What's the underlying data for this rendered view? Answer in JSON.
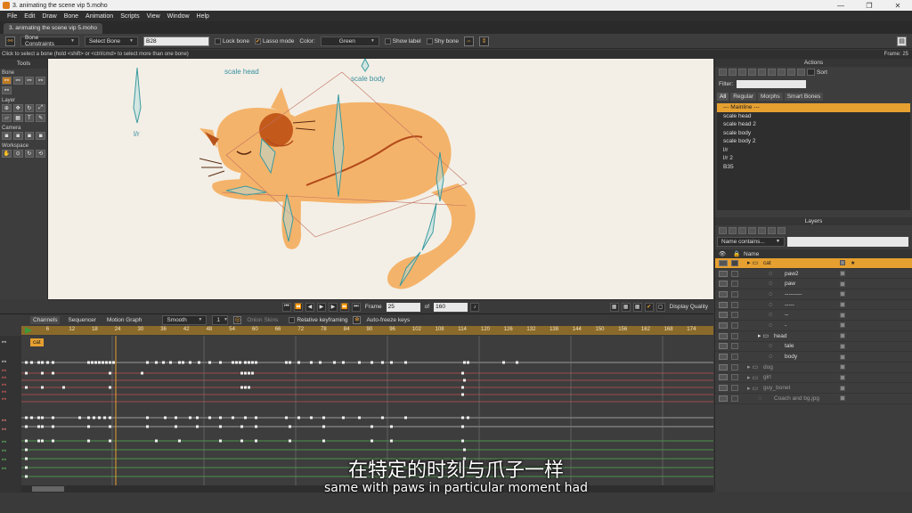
{
  "window": {
    "title": "3. animating the scene vip 5.moho",
    "controls": [
      "—",
      "❐",
      "✕"
    ]
  },
  "menu": [
    "File",
    "Edit",
    "Draw",
    "Bone",
    "Animation",
    "Scripts",
    "View",
    "Window",
    "Help"
  ],
  "doc_tab": "3. animating the scene vip 5.moho",
  "tool_options": {
    "bone_constraints": "Bone Constraints",
    "select_bone": "Select Bone",
    "bone_name": "B28",
    "lock_bone": "Lock bone",
    "lasso_mode": "Lasso mode",
    "color_label": "Color:",
    "color_value": "Green",
    "show_label": "Show label",
    "shy_bone": "Shy bone"
  },
  "status": {
    "hint": "Click to select a bone (hold <shift> or <ctrl/cmd> to select more than one bone)",
    "frame": "Frame: 25"
  },
  "tools": {
    "header": "Tools",
    "sections": [
      "Bone",
      "Layer",
      "Camera",
      "Workspace"
    ]
  },
  "canvas": {
    "labels": {
      "scale_head": "scale head",
      "scale_body": "scale body",
      "lr": "l/r"
    }
  },
  "playbar": {
    "frame_label": "Frame",
    "frame_value": "25",
    "of_label": "of",
    "total_frames": "160",
    "display_quality": "Display Quality"
  },
  "timeline": {
    "tabs": [
      "Channels",
      "Sequencer",
      "Motion Graph"
    ],
    "interp": "Smooth",
    "interp_num": "1",
    "onion_skins": "Onion Skins",
    "relative_keyframing": "Relative keyframing",
    "auto_freeze": "Auto-freeze keys",
    "ruler": [
      "6",
      "12",
      "18",
      "24",
      "30",
      "36",
      "42",
      "48",
      "54",
      "60",
      "66",
      "72",
      "78",
      "84",
      "90",
      "96",
      "102",
      "108",
      "114",
      "120",
      "126",
      "132",
      "138",
      "144",
      "150",
      "156",
      "162",
      "168",
      "174"
    ],
    "cat_label": "cat"
  },
  "actions": {
    "header": "Actions",
    "sort_label": "Sort",
    "filter_label": "Filter:",
    "tabs": [
      "All",
      "Regular",
      "Morphs",
      "Smart Bones"
    ],
    "items": [
      "--- Mainline ---",
      "scale head",
      "scale head 2",
      "scale body",
      "scale body 2",
      "l/r",
      "l/r 2",
      "B35"
    ]
  },
  "layers": {
    "header": "Layers",
    "name_filter": "Name contains...",
    "col_name": "Name",
    "rows": [
      {
        "name": "cat",
        "indent": 0
      },
      {
        "name": "paw2",
        "indent": 2
      },
      {
        "name": "paw",
        "indent": 2
      },
      {
        "name": "---------",
        "indent": 2
      },
      {
        "name": "-----",
        "indent": 2
      },
      {
        "name": "--",
        "indent": 2
      },
      {
        "name": "-",
        "indent": 2
      },
      {
        "name": "head",
        "indent": 1
      },
      {
        "name": "tale",
        "indent": 2
      },
      {
        "name": "body",
        "indent": 2
      },
      {
        "name": "dog",
        "indent": 0
      },
      {
        "name": "girl",
        "indent": 0
      },
      {
        "name": "guy_bonet",
        "indent": 0
      },
      {
        "name": "Coach and bg.jpg",
        "indent": 1
      }
    ]
  },
  "subtitles": {
    "zh": "在特定的时刻与爪子一样",
    "en": "same with paws in particular moment had"
  }
}
